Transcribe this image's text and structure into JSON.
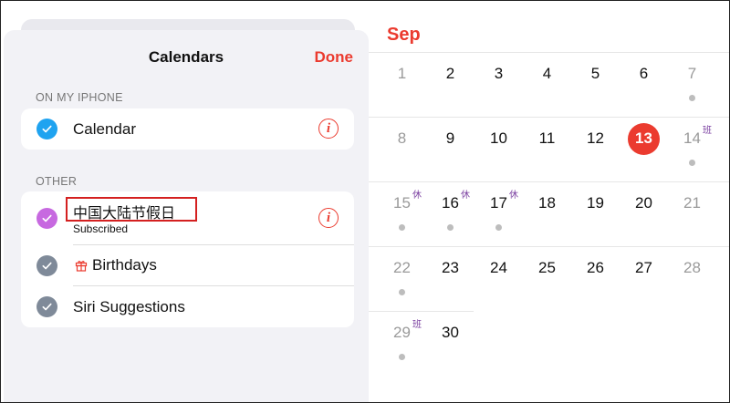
{
  "sheet": {
    "title": "Calendars",
    "done_label": "Done",
    "sections": [
      {
        "header": "ON MY IPHONE",
        "items": [
          {
            "label": "Calendar",
            "color": "#1fa3f0",
            "checked": true
          }
        ]
      },
      {
        "header": "OTHER",
        "items": [
          {
            "label": "中国大陆节假日",
            "sublabel": "Subscribed",
            "color": "#c769e0",
            "checked": true
          },
          {
            "label": "Birthdays",
            "color": "#7f8a99",
            "checked": true,
            "icon": "gift-icon"
          },
          {
            "label": "Siri Suggestions",
            "color": "#7f8a99",
            "checked": true
          }
        ]
      }
    ]
  },
  "calendar": {
    "month": "Sep",
    "accent_color": "#eb3b2f",
    "weeks": [
      [
        {
          "d": "1"
        },
        {
          "d": "2"
        },
        {
          "d": "3"
        },
        {
          "d": "4"
        },
        {
          "d": "5"
        },
        {
          "d": "6"
        },
        {
          "d": "7",
          "dot": true
        }
      ],
      [
        {
          "d": "8"
        },
        {
          "d": "9"
        },
        {
          "d": "10"
        },
        {
          "d": "11"
        },
        {
          "d": "12"
        },
        {
          "d": "13",
          "today": true
        },
        {
          "d": "14",
          "tag": "班",
          "dot": true
        }
      ],
      [
        {
          "d": "15",
          "tag": "休",
          "dot": true
        },
        {
          "d": "16",
          "tag": "休",
          "dot": true
        },
        {
          "d": "17",
          "tag": "休",
          "dot": true
        },
        {
          "d": "18"
        },
        {
          "d": "19"
        },
        {
          "d": "20"
        },
        {
          "d": "21"
        }
      ],
      [
        {
          "d": "22",
          "dot": true
        },
        {
          "d": "23"
        },
        {
          "d": "24"
        },
        {
          "d": "25"
        },
        {
          "d": "26"
        },
        {
          "d": "27"
        },
        {
          "d": "28"
        }
      ],
      [
        {
          "d": "29",
          "tag": "班",
          "dot": true
        },
        {
          "d": "30"
        }
      ]
    ]
  }
}
